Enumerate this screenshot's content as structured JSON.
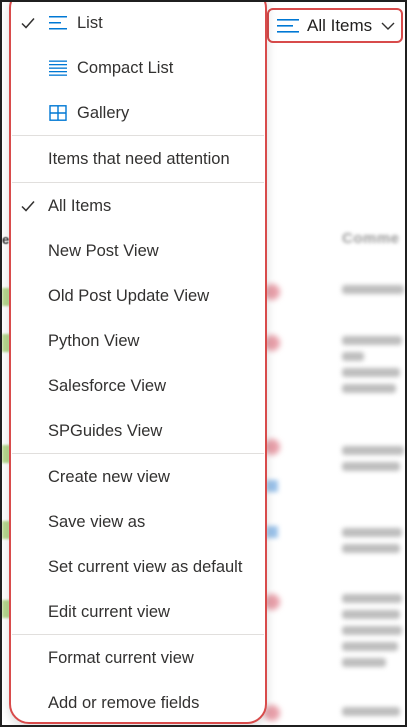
{
  "view_button": {
    "label": "All Items",
    "icon": "list-lines-icon",
    "chevron": "chevron-down-icon"
  },
  "menu": {
    "layout_options": [
      {
        "label": "List",
        "icon": "list-icon",
        "checked": true
      },
      {
        "label": "Compact List",
        "icon": "compact-list-icon",
        "checked": false
      },
      {
        "label": "Gallery",
        "icon": "gallery-icon",
        "checked": false
      }
    ],
    "attention_item": {
      "label": "Items that need attention"
    },
    "views": [
      {
        "label": "All Items",
        "checked": true
      },
      {
        "label": "New Post View",
        "checked": false
      },
      {
        "label": "Old Post Update View",
        "checked": false
      },
      {
        "label": "Python View",
        "checked": false
      },
      {
        "label": "Salesforce View",
        "checked": false
      },
      {
        "label": "SPGuides View",
        "checked": false
      }
    ],
    "view_actions": [
      {
        "label": "Create new view"
      },
      {
        "label": "Save view as"
      },
      {
        "label": "Set current view as default"
      },
      {
        "label": "Edit current view"
      }
    ],
    "format_actions": [
      {
        "label": "Format current view"
      },
      {
        "label": "Add or remove fields"
      }
    ]
  },
  "colors": {
    "accent": "#0078d4",
    "highlight_border": "#d84b4b",
    "text": "#323130"
  }
}
